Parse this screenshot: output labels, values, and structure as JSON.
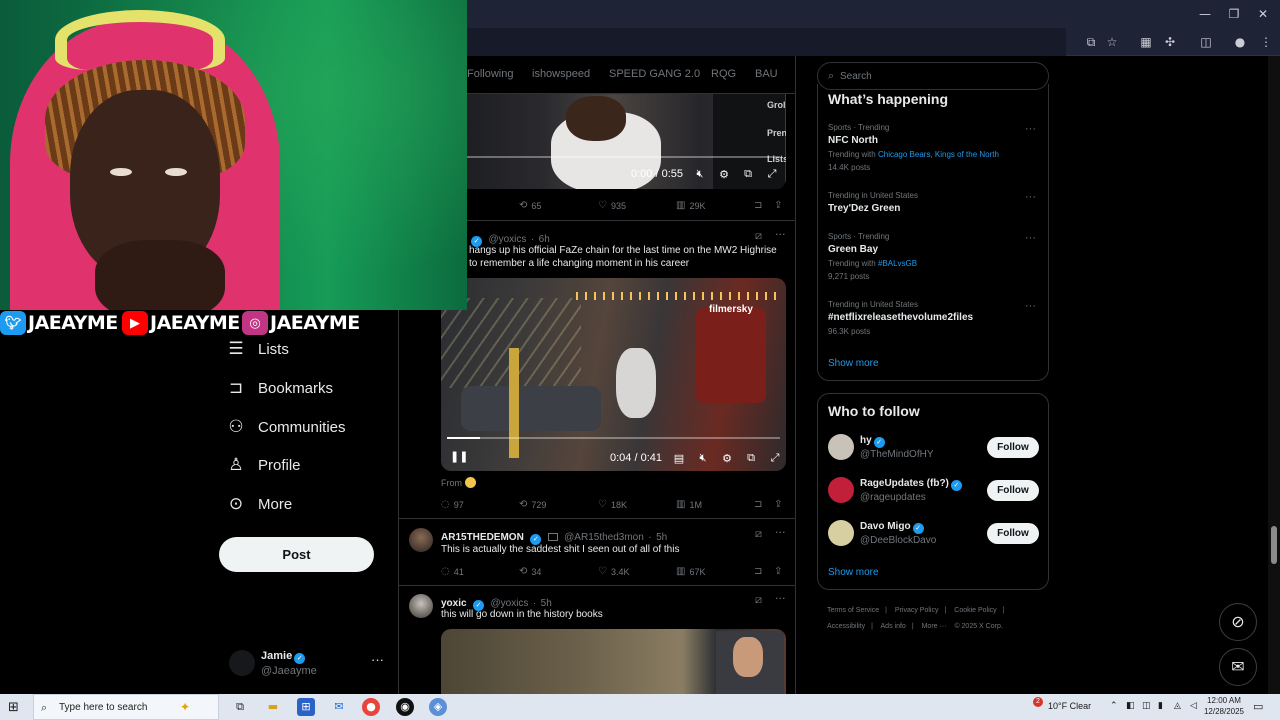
{
  "browser": {
    "window_controls": {
      "minimize": "—",
      "restore": "❐",
      "close": "✕"
    },
    "toolbar_icons": [
      "cast-icon",
      "star-icon",
      "extensions-icon",
      "puzzle-icon",
      "sidebar-icon",
      "profile-icon",
      "menu-icon"
    ]
  },
  "overlay": {
    "socials": [
      {
        "platform": "twitter",
        "handle": "JAEAYME",
        "color": "#1d9bf0"
      },
      {
        "platform": "youtube",
        "handle": "JAEAYME",
        "color": "#ff0000"
      },
      {
        "platform": "instagram",
        "handle": "JAEAYME",
        "color": "#c13584"
      }
    ]
  },
  "nav": {
    "items": [
      {
        "label": "Lists",
        "icon": "lists-icon"
      },
      {
        "label": "Bookmarks",
        "icon": "bookmark-icon"
      },
      {
        "label": "Communities",
        "icon": "communities-icon"
      },
      {
        "label": "Profile",
        "icon": "profile-icon"
      },
      {
        "label": "More",
        "icon": "more-circle-icon"
      }
    ],
    "post_label": "Post",
    "account": {
      "name": "Jamie",
      "handle": "@Jaeayme",
      "more": "···"
    }
  },
  "timeline": {
    "tabs": [
      "Following",
      "ishowspeed",
      "SPEED GANG 2.0",
      "RQG",
      "BAU"
    ],
    "video1": {
      "time": "0:00 / 0:55",
      "progress": 0.0,
      "overlay_texts": [
        "Grol",
        "Pren",
        "Lists"
      ],
      "actions": {
        "reposts": "65",
        "likes": "935",
        "views": "29K"
      }
    },
    "tweet1": {
      "handle": "@yoxics",
      "time": "6h",
      "text_line1": "hangs up his official FaZe chain for the last time on the MW2 Highrise",
      "text_line2": "to remember a life changing moment in his career",
      "video_watermark": "filmersky",
      "video_time": "0:04 / 0:41",
      "progress": 0.1,
      "from_label": "From",
      "actions": {
        "replies": "97",
        "reposts": "729",
        "likes": "18K",
        "views": "1M"
      }
    },
    "tweet2": {
      "name": "AR15THEDEMON",
      "handle": "@AR15thed3mon",
      "time": "5h",
      "text": "This is actually the saddest shit I seen out of all of this",
      "actions": {
        "replies": "41",
        "reposts": "34",
        "likes": "3.4K",
        "views": "67K"
      }
    },
    "tweet3": {
      "name": "yoxic",
      "handle": "@yoxics",
      "time": "5h",
      "text": "this will go down in the history books"
    }
  },
  "sidebar": {
    "search_placeholder": "Search",
    "happening_title": "What’s happening",
    "trends": [
      {
        "meta": "Sports · Trending",
        "title": "NFC North",
        "ctx_prefix": "Trending with",
        "ctx_links": "Chicago Bears, Kings of the North",
        "posts": "14.4K posts"
      },
      {
        "meta": "Trending in United States",
        "title": "Trey'Dez Green",
        "ctx_prefix": "",
        "ctx_links": "",
        "posts": ""
      },
      {
        "meta": "Sports · Trending",
        "title": "Green Bay",
        "ctx_prefix": "Trending with",
        "ctx_links": "#BALvsGB",
        "posts": "9,271 posts"
      },
      {
        "meta": "Trending in United States",
        "title": "#netflixreleasethevolume2files",
        "ctx_prefix": "",
        "ctx_links": "",
        "posts": "96.3K posts"
      }
    ],
    "show_more": "Show more",
    "wtf_title": "Who to follow",
    "who_to_follow": [
      {
        "name": "hy",
        "handle": "@TheMindOfHY",
        "button": "Follow",
        "avatar_color": "#c9c2b8"
      },
      {
        "name": "RageUpdates (fb?)",
        "handle": "@rageupdates",
        "button": "Follow",
        "avatar_color": "#c21f3a"
      },
      {
        "name": "Davo Migo",
        "handle": "@DeeBlockDavo",
        "button": "Follow",
        "avatar_color": "#d8cfa0"
      }
    ],
    "footer": [
      "Terms of Service",
      "|",
      "Privacy Policy",
      "|",
      "Cookie Policy",
      "|",
      "Accessibility",
      "|",
      "Ads info",
      "|",
      "More ···",
      "© 2025 X Corp."
    ]
  },
  "taskbar": {
    "search_placeholder": "Type here to search",
    "weather": "10°F  Clear",
    "weather_badge": "2",
    "time": "12:00 AM",
    "date": "12/28/2025"
  },
  "colors": {
    "accent": "#1d9bf0",
    "background": "#000000",
    "border": "#2f3336"
  }
}
